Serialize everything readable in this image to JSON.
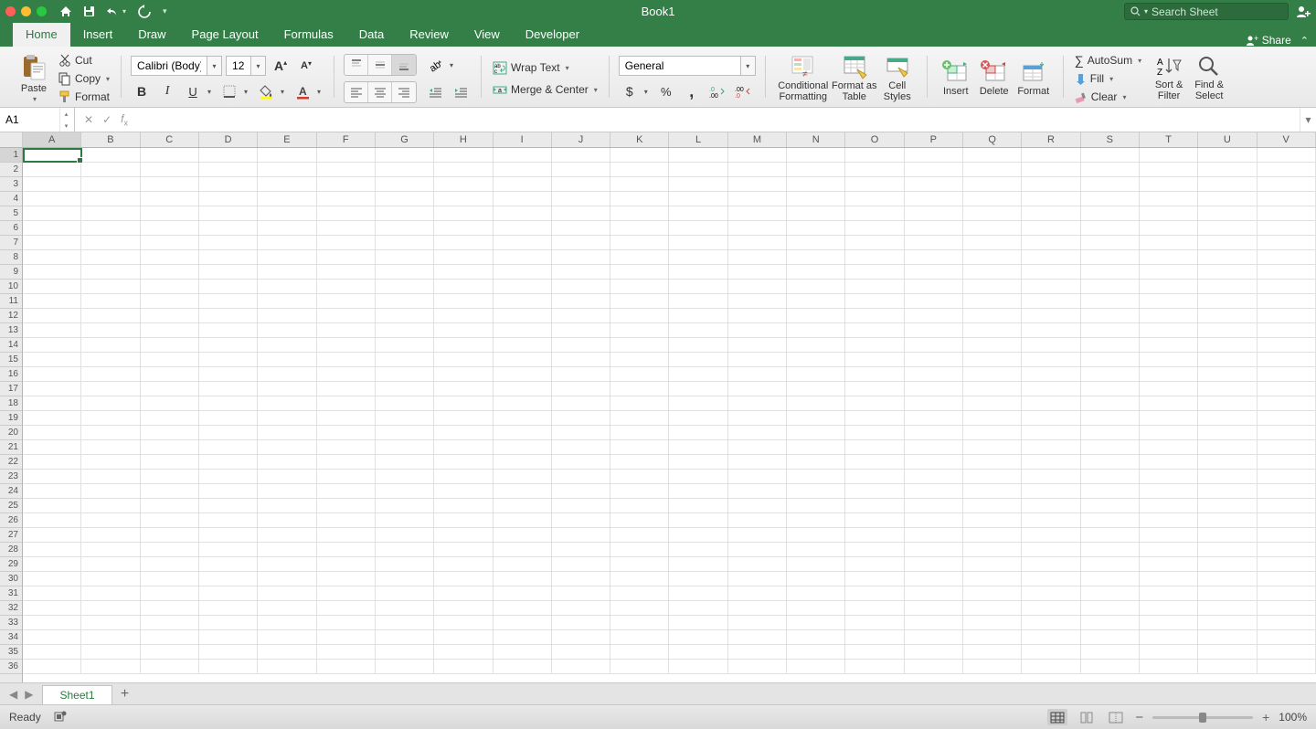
{
  "titlebar": {
    "title": "Book1",
    "search_placeholder": "Search Sheet"
  },
  "tabs": {
    "items": [
      "Home",
      "Insert",
      "Draw",
      "Page Layout",
      "Formulas",
      "Data",
      "Review",
      "View",
      "Developer"
    ],
    "active": "Home",
    "share": "Share"
  },
  "ribbon": {
    "clipboard": {
      "paste": "Paste",
      "cut": "Cut",
      "copy": "Copy",
      "format": "Format"
    },
    "font": {
      "name": "Calibri (Body)",
      "size": "12"
    },
    "alignment": {
      "wrap": "Wrap Text",
      "merge": "Merge & Center"
    },
    "number": {
      "format": "General"
    },
    "styles": {
      "cond": "Conditional Formatting",
      "table": "Format as Table",
      "cell": "Cell Styles"
    },
    "cells": {
      "insert": "Insert",
      "delete": "Delete",
      "format": "Format"
    },
    "editing": {
      "autosum": "AutoSum",
      "fill": "Fill",
      "clear": "Clear",
      "sort": "Sort & Filter",
      "find": "Find & Select"
    }
  },
  "formula_bar": {
    "name_box": "A1"
  },
  "grid": {
    "columns": [
      "A",
      "B",
      "C",
      "D",
      "E",
      "F",
      "G",
      "H",
      "I",
      "J",
      "K",
      "L",
      "M",
      "N",
      "O",
      "P",
      "Q",
      "R",
      "S",
      "T",
      "U",
      "V"
    ],
    "rows": [
      1,
      2,
      3,
      4,
      5,
      6,
      7,
      8,
      9,
      10,
      11,
      12,
      13,
      14,
      15,
      16,
      17,
      18,
      19,
      20,
      21,
      22,
      23,
      24,
      25,
      26,
      27,
      28,
      29,
      30,
      31,
      32,
      33,
      34,
      35,
      36
    ],
    "selected": "A1"
  },
  "sheet_tabs": {
    "sheet": "Sheet1"
  },
  "status": {
    "state": "Ready",
    "zoom": "100%"
  }
}
